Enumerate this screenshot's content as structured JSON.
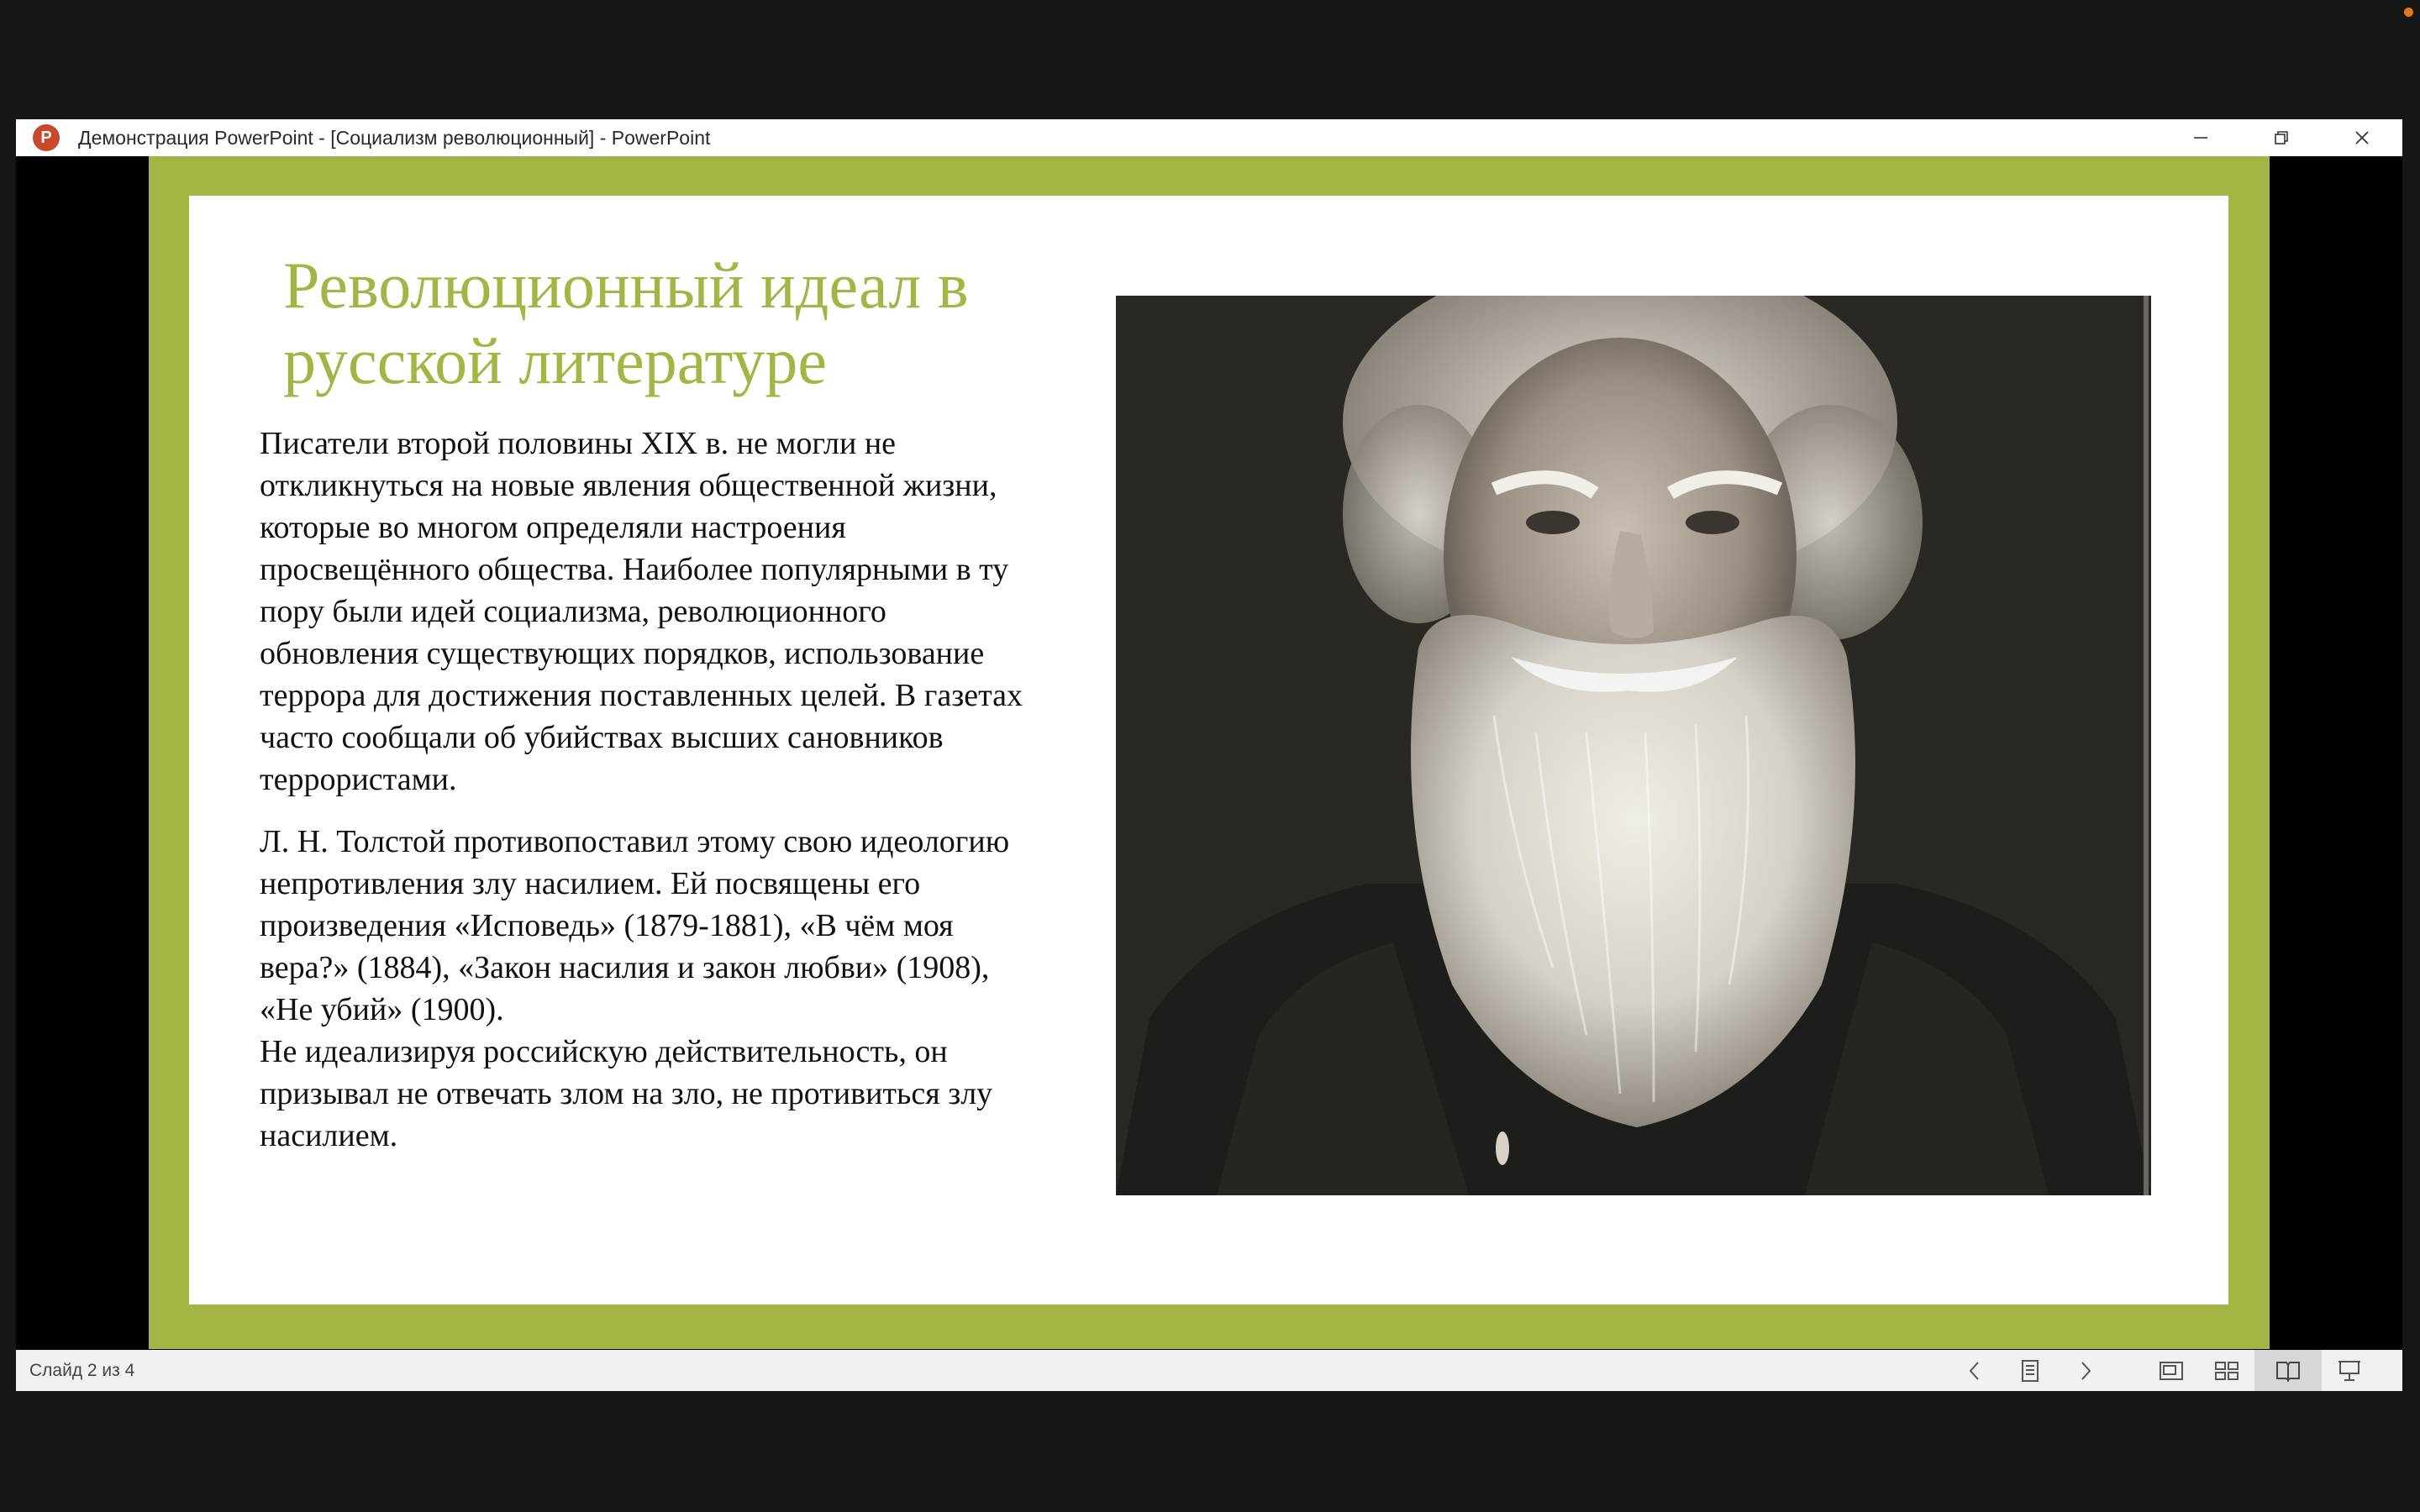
{
  "window": {
    "title": "Демонстрация PowerPoint - [Социализм  революционный] - PowerPoint",
    "app_icon_letter": "P",
    "controls": [
      "minimize-icon",
      "restore-icon",
      "close-icon"
    ]
  },
  "slide": {
    "title": "Революционный идеал в русской литературе",
    "paragraphs": [
      "Писатели второй половины XIX в. не могли не откликнуться на новые явления общественной жизни, которые во многом определяли настроения просвещённого общества. Наиболее популярными в ту пору были идей социализма, революционного обновления существующих порядков, использование террора для достижения поставленных целей. В газетах часто сообщали об убийствах высших сановников террористами.",
      "Л. Н. Толстой противопоставил этому свою идеологию непротивления злу насилием. Ей посвящены его произведения «Исповедь» (1879-1881), «В чём моя вера?» (1884), «Закон насилия и закон любви» (1908), «Не убий» (1900).",
      "Не идеализируя российскую действительность, он призывал не отвечать злом на зло, не противиться злу насилием."
    ],
    "photo_icon": "portrait-photo"
  },
  "statusbar": {
    "slide_counter": "Слайд 2 из 4",
    "icons": [
      "previous-icon",
      "notes-menu-icon",
      "next-icon",
      "normal-view-icon",
      "slide-sorter-icon",
      "reading-view-icon",
      "slideshow-icon"
    ]
  },
  "colors": {
    "accent": "#a5b545",
    "background": "#161616"
  }
}
